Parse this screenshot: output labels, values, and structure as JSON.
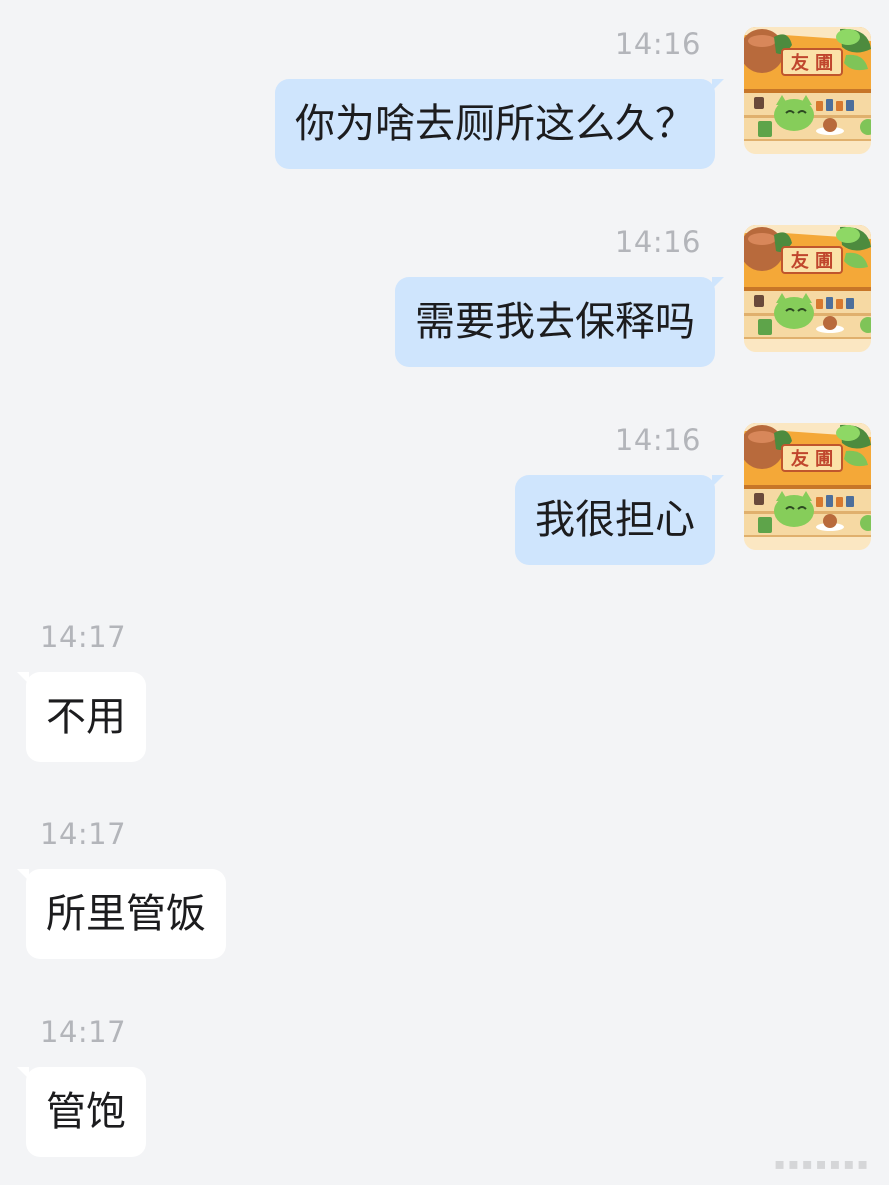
{
  "messages": [
    {
      "direction": "outgoing",
      "time": "14:16",
      "text": "你为啥去厕所这么久？"
    },
    {
      "direction": "outgoing",
      "time": "14:16",
      "text": "需要我去保释吗"
    },
    {
      "direction": "outgoing",
      "time": "14:16",
      "text": "我很担心"
    },
    {
      "direction": "incoming",
      "time": "14:17",
      "text": "不用"
    },
    {
      "direction": "incoming",
      "time": "14:17",
      "text": "所里管饭"
    },
    {
      "direction": "incoming",
      "time": "14:17",
      "text": "管饱"
    }
  ],
  "avatar": {
    "sign_text": "友 圃",
    "icon": "tea-shop-cartoon-avatar"
  },
  "colors": {
    "background": "#f3f4f6",
    "outgoing_bubble": "#cfe5fd",
    "incoming_bubble": "#ffffff",
    "timestamp": "#b3b5ba",
    "text": "#1c1c1e"
  }
}
